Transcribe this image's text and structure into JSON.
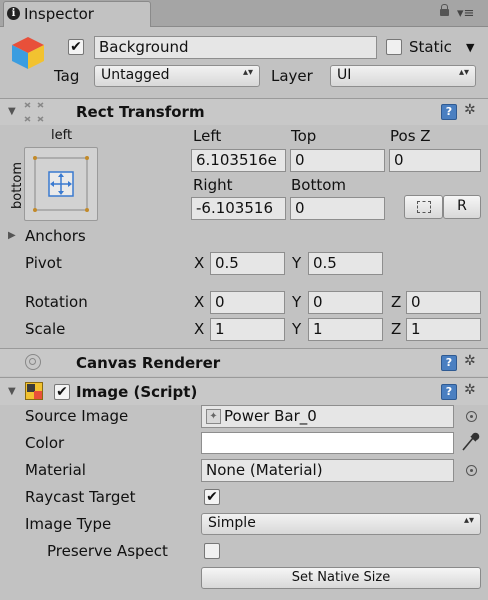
{
  "tab": {
    "title": "Inspector"
  },
  "gameobject": {
    "name": "Background",
    "active": true,
    "static_label": "Static",
    "static_checked": false,
    "tag_label": "Tag",
    "tag_value": "Untagged",
    "layer_label": "Layer",
    "layer_value": "UI"
  },
  "rect_transform": {
    "title": "Rect Transform",
    "anchor_top_label": "left",
    "anchor_side_label": "bottom",
    "left_label": "Left",
    "left_value": "6.103516e",
    "top_label": "Top",
    "top_value": "0",
    "posz_label": "Pos Z",
    "posz_value": "0",
    "right_label": "Right",
    "right_value": "-6.103516",
    "bottom_label": "Bottom",
    "bottom_value": "0",
    "raw_button": "R",
    "anchors_label": "Anchors",
    "pivot_label": "Pivot",
    "pivot_x": "0.5",
    "pivot_y": "0.5",
    "rotation_label": "Rotation",
    "rotation_x": "0",
    "rotation_y": "0",
    "rotation_z": "0",
    "scale_label": "Scale",
    "scale_x": "1",
    "scale_y": "1",
    "scale_z": "1",
    "x": "X",
    "y": "Y",
    "z": "Z"
  },
  "canvas_renderer": {
    "title": "Canvas Renderer"
  },
  "image": {
    "title": "Image (Script)",
    "enabled": true,
    "source_image_label": "Source Image",
    "source_image_value": "Power Bar_0",
    "color_label": "Color",
    "color_value": "#ffffff",
    "material_label": "Material",
    "material_value": "None (Material)",
    "raycast_label": "Raycast Target",
    "raycast_checked": true,
    "image_type_label": "Image Type",
    "image_type_value": "Simple",
    "preserve_label": "Preserve Aspect",
    "preserve_checked": false,
    "native_size_button": "Set Native Size"
  },
  "icons": [
    "info-icon",
    "lock-icon",
    "menu-icon",
    "cube-icon",
    "checkmark-icon",
    "rect-transform-icon",
    "anchor-preset-icon",
    "help-icon",
    "gear-icon",
    "canvas-renderer-icon",
    "image-script-icon",
    "sprite-icon",
    "object-picker-icon",
    "eyedropper-icon"
  ]
}
